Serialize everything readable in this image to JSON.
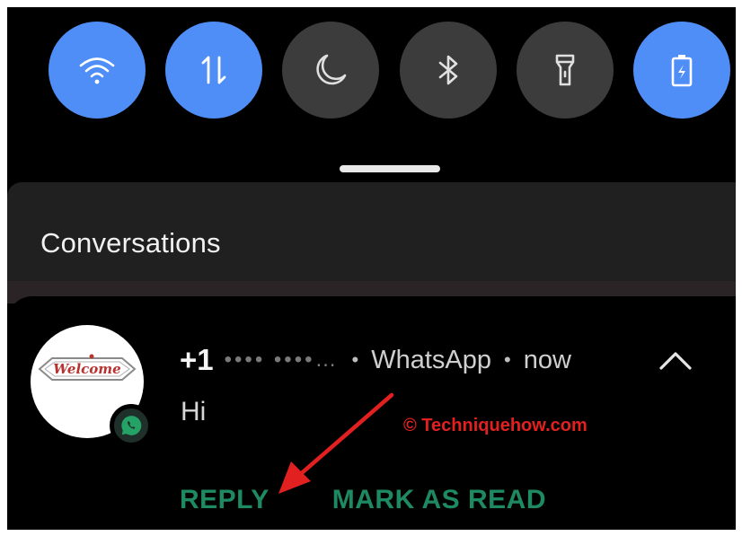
{
  "quick_settings": {
    "tiles": [
      {
        "name": "wifi",
        "icon": "wifi-icon",
        "active": true
      },
      {
        "name": "mobile-data",
        "icon": "data-arrows-icon",
        "active": true
      },
      {
        "name": "do-not-disturb",
        "icon": "moon-icon",
        "active": false
      },
      {
        "name": "bluetooth",
        "icon": "bluetooth-icon",
        "active": false
      },
      {
        "name": "flashlight",
        "icon": "flashlight-icon",
        "active": false
      },
      {
        "name": "battery-saver",
        "icon": "battery-icon",
        "active": true
      }
    ],
    "active_color": "#4f8ef7",
    "inactive_color": "#3c3c3c"
  },
  "section": {
    "title": "Conversations"
  },
  "notification": {
    "sender": "+1",
    "sender_masked": "•••• ••••…",
    "app": "WhatsApp",
    "separator": "•",
    "time": "now",
    "message": "Hi",
    "avatar_text": "Welcome",
    "actions": {
      "reply": "REPLY",
      "mark_read": "MARK AS READ"
    },
    "accent_color": "#1e8a62"
  },
  "watermark": "© Techniquehow.com"
}
